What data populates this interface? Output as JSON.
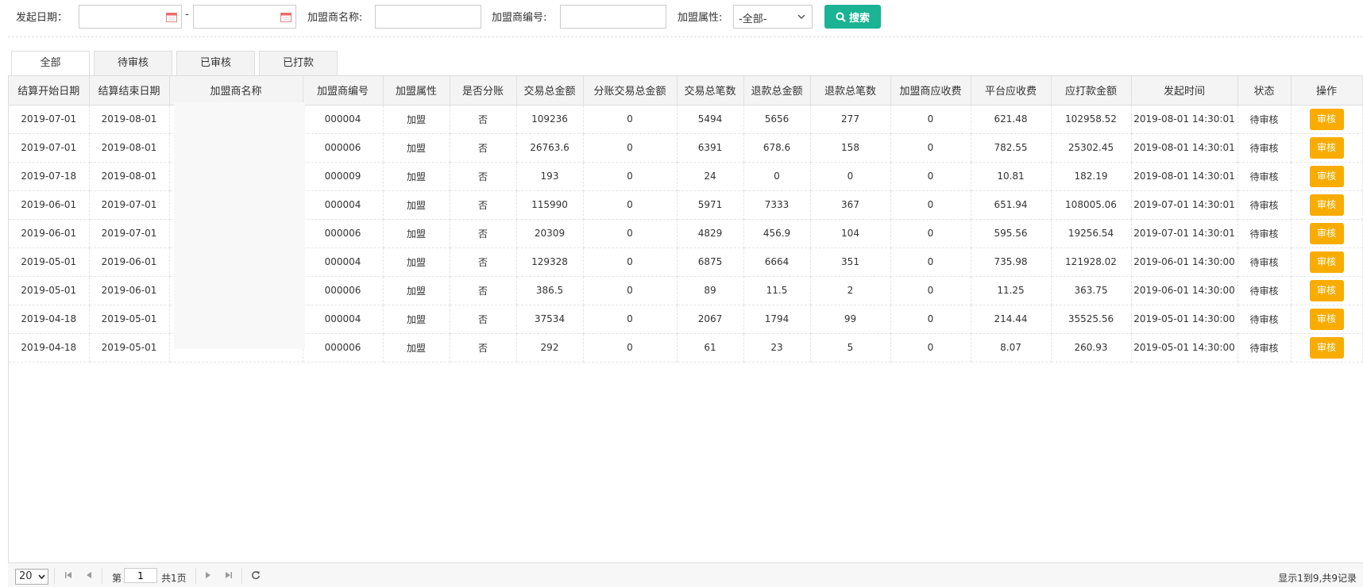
{
  "filters": {
    "start_date_label": "发起日期：",
    "start_date_value": "",
    "date_separator": "-",
    "end_date_value": "",
    "merchant_name_label": "加盟商名称:",
    "merchant_name_value": "",
    "merchant_no_label": "加盟商编号:",
    "merchant_no_value": "",
    "merchant_attr_label": "加盟属性:",
    "merchant_attr_selected": "-全部-",
    "search_label": "搜索"
  },
  "tabs": [
    {
      "label": "全部",
      "active": true
    },
    {
      "label": "待审核",
      "active": false
    },
    {
      "label": "已审核",
      "active": false
    },
    {
      "label": "已打款",
      "active": false
    }
  ],
  "table": {
    "headers": [
      "结算开始日期",
      "结算结束日期",
      "加盟商名称",
      "加盟商编号",
      "加盟属性",
      "是否分账",
      "交易总金额",
      "分账交易总金额",
      "交易总笔数",
      "退款总金额",
      "退款总笔数",
      "加盟商应收费",
      "平台应收费",
      "应打款金额",
      "发起时间",
      "状态",
      "操作"
    ],
    "action_label": "审核",
    "rows": [
      [
        "2019-07-01",
        "2019-08-01",
        "",
        "000004",
        "加盟",
        "否",
        "109236",
        "0",
        "5494",
        "5656",
        "277",
        "0",
        "621.48",
        "102958.52",
        "2019-08-01 14:30:01",
        "待审核"
      ],
      [
        "2019-07-01",
        "2019-08-01",
        "",
        "000006",
        "加盟",
        "否",
        "26763.6",
        "0",
        "6391",
        "678.6",
        "158",
        "0",
        "782.55",
        "25302.45",
        "2019-08-01 14:30:01",
        "待审核"
      ],
      [
        "2019-07-18",
        "2019-08-01",
        "",
        "000009",
        "加盟",
        "否",
        "193",
        "0",
        "24",
        "0",
        "0",
        "0",
        "10.81",
        "182.19",
        "2019-08-01 14:30:01",
        "待审核"
      ],
      [
        "2019-06-01",
        "2019-07-01",
        "",
        "000004",
        "加盟",
        "否",
        "115990",
        "0",
        "5971",
        "7333",
        "367",
        "0",
        "651.94",
        "108005.06",
        "2019-07-01 14:30:01",
        "待审核"
      ],
      [
        "2019-06-01",
        "2019-07-01",
        "",
        "000006",
        "加盟",
        "否",
        "20309",
        "0",
        "4829",
        "456.9",
        "104",
        "0",
        "595.56",
        "19256.54",
        "2019-07-01 14:30:01",
        "待审核"
      ],
      [
        "2019-05-01",
        "2019-06-01",
        "",
        "000004",
        "加盟",
        "否",
        "129328",
        "0",
        "6875",
        "6664",
        "351",
        "0",
        "735.98",
        "121928.02",
        "2019-06-01 14:30:00",
        "待审核"
      ],
      [
        "2019-05-01",
        "2019-06-01",
        "",
        "000006",
        "加盟",
        "否",
        "386.5",
        "0",
        "89",
        "11.5",
        "2",
        "0",
        "11.25",
        "363.75",
        "2019-06-01 14:30:00",
        "待审核"
      ],
      [
        "2019-04-18",
        "2019-05-01",
        "",
        "000004",
        "加盟",
        "否",
        "37534",
        "0",
        "2067",
        "1794",
        "99",
        "0",
        "214.44",
        "35525.56",
        "2019-05-01 14:30:00",
        "待审核"
      ],
      [
        "2019-04-18",
        "2019-05-01",
        "",
        "000006",
        "加盟",
        "否",
        "292",
        "0",
        "61",
        "23",
        "5",
        "0",
        "8.07",
        "260.93",
        "2019-05-01 14:30:00",
        "待审核"
      ]
    ]
  },
  "pager": {
    "page_size": "20",
    "page_prefix": "第",
    "current_page": "1",
    "total_pages": "共1页",
    "info": "显示1到9,共9记录"
  },
  "colors": {
    "search_button": "#1ab394",
    "audit_button": "#f8ac00"
  }
}
